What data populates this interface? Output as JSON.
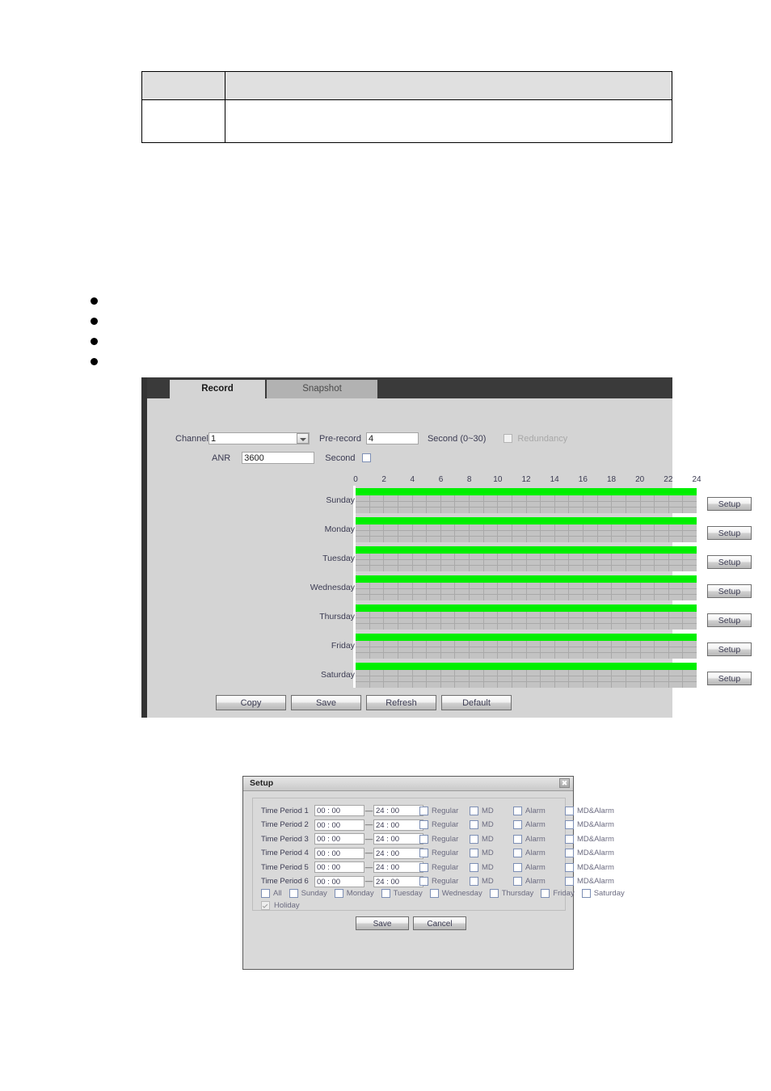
{
  "doc_table": {
    "header_cells": [
      "",
      ""
    ],
    "body_cells": [
      "",
      ""
    ]
  },
  "bullets": [
    "",
    "",
    "",
    ""
  ],
  "panel": {
    "tabs": [
      {
        "label": "Record",
        "active": true
      },
      {
        "label": "Snapshot",
        "active": false
      }
    ],
    "form": {
      "channel_label": "Channel",
      "channel_value": "1",
      "prerecord_label": "Pre-record",
      "prerecord_value": "4",
      "prerecord_unit": "Second (0~30)",
      "redundancy_label": "Redundancy",
      "redundancy_checked": false,
      "redundancy_disabled": true,
      "anr_label": "ANR",
      "anr_value": "3600",
      "anr_unit": "Second",
      "anr_checked": false
    },
    "schedule": {
      "ruler_ticks": [
        "0",
        "2",
        "4",
        "6",
        "8",
        "10",
        "12",
        "14",
        "16",
        "18",
        "20",
        "22",
        "24"
      ],
      "setup_label": "Setup",
      "days": [
        {
          "name": "Sunday",
          "green_from": 0,
          "green_to": 24
        },
        {
          "name": "Monday",
          "green_from": 0,
          "green_to": 24
        },
        {
          "name": "Tuesday",
          "green_from": 0,
          "green_to": 24
        },
        {
          "name": "Wednesday",
          "green_from": 0,
          "green_to": 24
        },
        {
          "name": "Thursday",
          "green_from": 0,
          "green_to": 24
        },
        {
          "name": "Friday",
          "green_from": 0,
          "green_to": 24
        },
        {
          "name": "Saturday",
          "green_from": 0,
          "green_to": 24
        }
      ],
      "green_color": "#00ef00",
      "grid_color": "#c3c3c3"
    },
    "buttons": [
      "Copy",
      "Save",
      "Refresh",
      "Default"
    ]
  },
  "dialog": {
    "title": "Setup",
    "close_icon": "close-icon",
    "period_labels": [
      "Time Period 1",
      "Time Period 2",
      "Time Period 3",
      "Time Period 4",
      "Time Period 5",
      "Time Period 6"
    ],
    "period_start": "00 : 00",
    "period_end": "24 : 00",
    "dash": "—",
    "mode_labels": [
      "Regular",
      "MD",
      "Alarm",
      "MD&Alarm"
    ],
    "day_labels": [
      "All",
      "Sunday",
      "Monday",
      "Tuesday",
      "Wednesday",
      "Thursday",
      "Friday",
      "Saturday"
    ],
    "holiday_label": "Holiday",
    "holiday_checked": true,
    "holiday_disabled": true,
    "save_label": "Save",
    "cancel_label": "Cancel"
  }
}
